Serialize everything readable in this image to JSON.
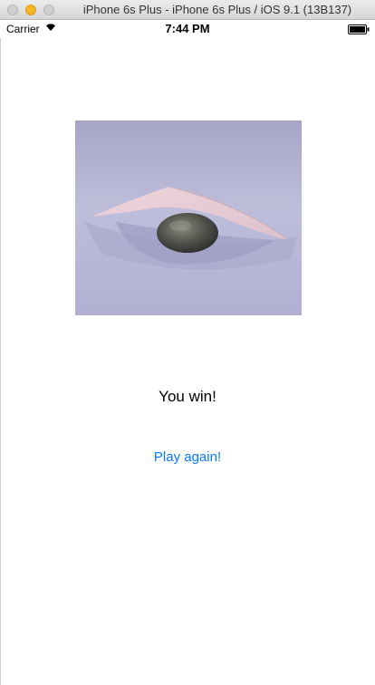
{
  "window": {
    "title": "iPhone 6s Plus - iPhone 6s Plus / iOS 9.1 (13B137)"
  },
  "status_bar": {
    "carrier": "Carrier",
    "time": "7:44 PM",
    "icons": [
      "wifi-icon",
      "battery-icon"
    ]
  },
  "main": {
    "image": {
      "subject": "rock-under-paper-icon"
    },
    "result_text": "You win!",
    "play_again_label": "Play again!"
  },
  "colors": {
    "accent": "#0a7aff",
    "text": "#000000",
    "background": "#ffffff"
  }
}
